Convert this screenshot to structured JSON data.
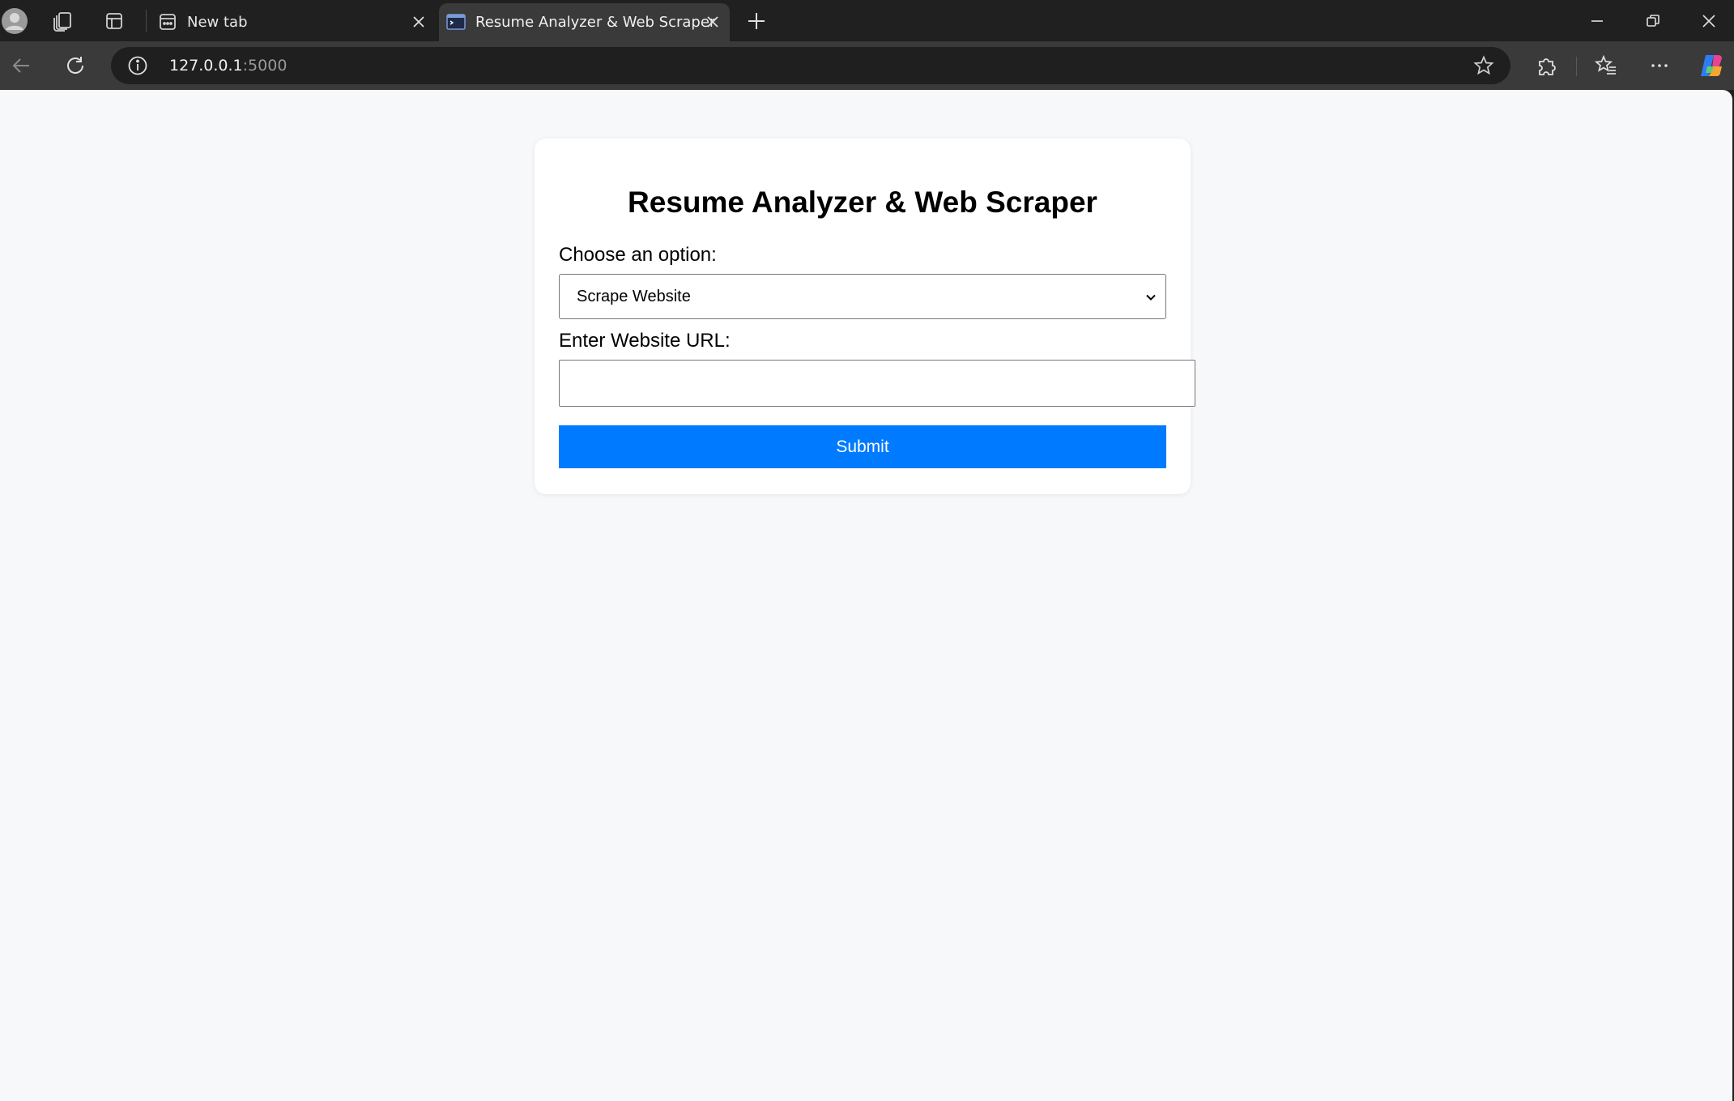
{
  "browser": {
    "tabs": [
      {
        "title": "New tab",
        "active": false,
        "favicon": "newtab-favicon-icon"
      },
      {
        "title": "Resume Analyzer & Web Scraper",
        "active": true,
        "favicon": "terminal-favicon-icon"
      }
    ],
    "address_bar": {
      "host": "127.0.0.1",
      "port": ":5000"
    },
    "colors": {
      "tab_strip": "#202020",
      "toolbar": "#3a3a3a",
      "omnibox": "#1f1f1f"
    }
  },
  "page": {
    "title": "Resume Analyzer & Web Scraper",
    "option_label": "Choose an option:",
    "option_selected": "Scrape Website",
    "url_label": "Enter Website URL:",
    "url_value": "",
    "submit_label": "Submit",
    "colors": {
      "background": "#f7f8fa",
      "card": "#ffffff",
      "button": "#007bff",
      "button_text": "#ffffff"
    }
  }
}
